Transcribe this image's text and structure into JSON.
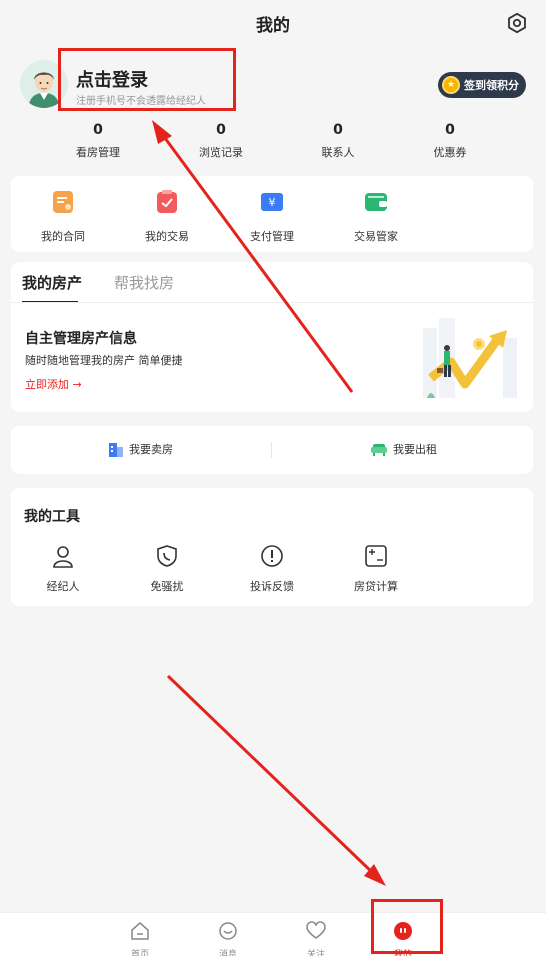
{
  "header": {
    "title": "我的"
  },
  "profile": {
    "login_title": "点击登录",
    "login_subtitle": "注册手机号不会透露给经纪人",
    "signin_label": "签到领积分"
  },
  "stats": [
    {
      "value": "0",
      "label": "看房管理"
    },
    {
      "value": "0",
      "label": "浏览记录"
    },
    {
      "value": "0",
      "label": "联系人"
    },
    {
      "value": "0",
      "label": "优惠券"
    }
  ],
  "services": [
    {
      "label": "我的合同",
      "icon": "contract-icon",
      "color": "#f6a24a"
    },
    {
      "label": "我的交易",
      "icon": "trade-icon",
      "color": "#f25b5b"
    },
    {
      "label": "支付管理",
      "icon": "payment-icon",
      "color": "#3b7cf6"
    },
    {
      "label": "交易管家",
      "icon": "wallet-icon",
      "color": "#2bb673"
    }
  ],
  "property": {
    "tabs": [
      "我的房产",
      "帮我找房"
    ],
    "title": "自主管理房产信息",
    "subtitle": "随时随地管理我的房产 简单便捷",
    "link": "立即添加 →"
  },
  "actions": [
    {
      "label": "我要卖房",
      "icon": "building-icon"
    },
    {
      "label": "我要出租",
      "icon": "sofa-icon"
    }
  ],
  "tools": {
    "title": "我的工具",
    "items": [
      {
        "label": "经纪人",
        "icon": "agent-icon"
      },
      {
        "label": "免骚扰",
        "icon": "phone-shield-icon"
      },
      {
        "label": "投诉反馈",
        "icon": "exclamation-icon"
      },
      {
        "label": "房贷计算",
        "icon": "calculator-icon"
      }
    ]
  },
  "tabbar": [
    {
      "label": "首页",
      "icon": "home-icon"
    },
    {
      "label": "消息",
      "icon": "message-icon"
    },
    {
      "label": "关注",
      "icon": "heart-icon"
    },
    {
      "label": "我的",
      "icon": "profile-icon"
    }
  ],
  "colors": {
    "accent": "#e5231d",
    "brand_dark": "#2e3a4c",
    "coin": "#f7b500"
  }
}
